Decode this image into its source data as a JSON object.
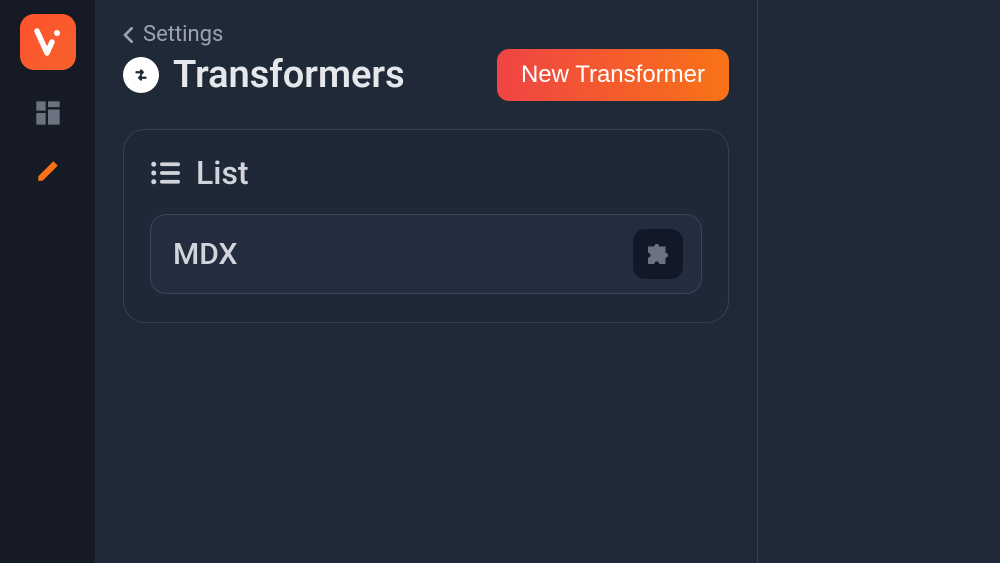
{
  "breadcrumb": {
    "parent": "Settings"
  },
  "page": {
    "title": "Transformers"
  },
  "actions": {
    "new_transformer": "New Transformer"
  },
  "card": {
    "title": "List"
  },
  "transformers": [
    {
      "name": "MDX"
    }
  ]
}
